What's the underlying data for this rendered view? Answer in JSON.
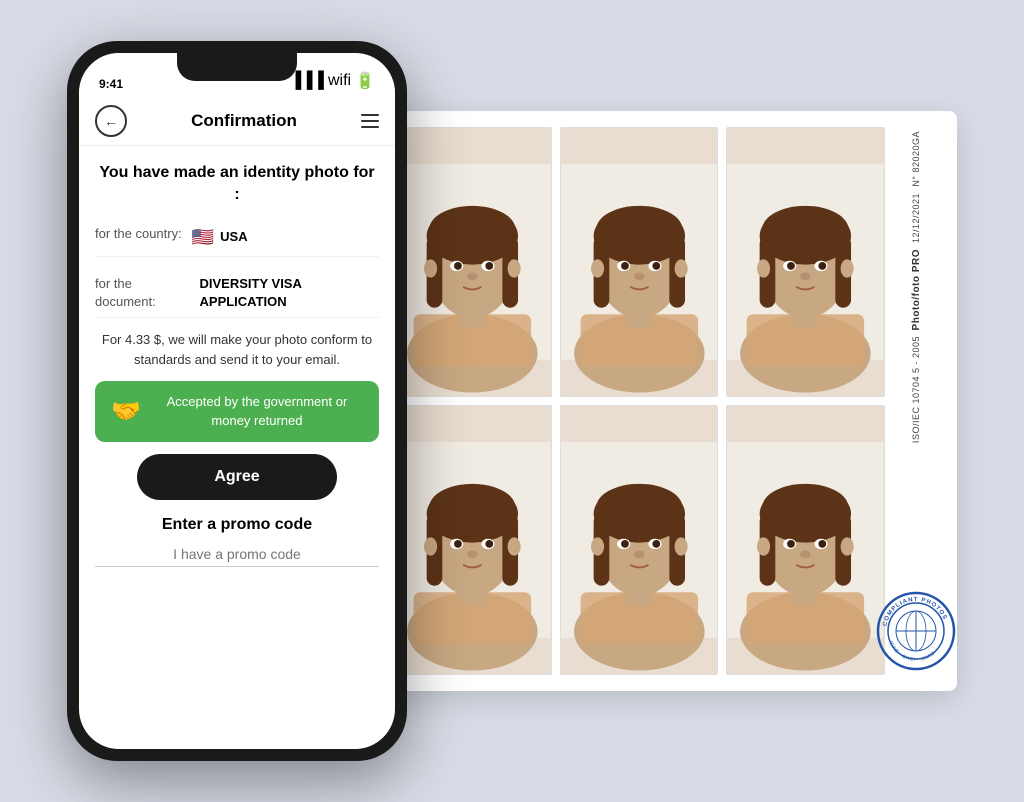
{
  "background_color": "#d8dce6",
  "phone": {
    "header": {
      "back_button": "‹",
      "title": "Confirmation",
      "menu_label": "menu"
    },
    "content": {
      "confirm_title": "You have made an identity photo for :",
      "country_label": "for the country:",
      "country_value": "USA",
      "country_flag": "🇺🇸",
      "document_label": "for the document:",
      "document_value": "DIVERSITY VISA APPLICATION",
      "price_text": "For 4.33 $, we will make your photo conform to standards and send it to your email.",
      "guarantee_text": "Accepted by the government or money returned",
      "guarantee_icon": "🤝",
      "agree_button": "Agree",
      "promo_title": "Enter a promo code",
      "promo_placeholder": "I have a promo code"
    }
  },
  "photo_sheet": {
    "serial_number": "N° 82020GA",
    "date": "12/12/2021",
    "brand": "Photo/foto PRO",
    "standard": "ISO/IEC 10704 5 - 2005",
    "stamp_text": "COMPLIANT PHOTOS",
    "stamp_inner": "ICAO OACI sMao"
  }
}
